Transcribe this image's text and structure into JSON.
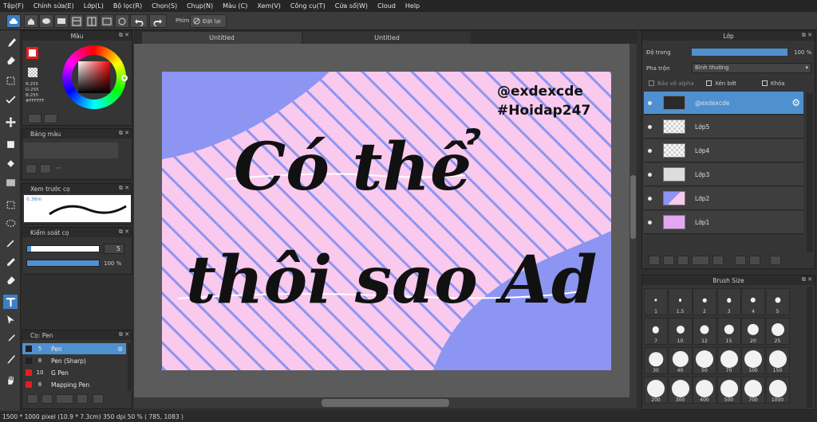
{
  "menu": [
    "Tệp(F)",
    "Chỉnh sửa(E)",
    "Lớp(L)",
    "Bộ lọc(R)",
    "Chọn(S)",
    "Chụp(N)",
    "Màu (C)",
    "Xem(V)",
    "Công cụ(T)",
    "Cửa sổ(W)",
    "Cloud",
    "Help"
  ],
  "toolbar": {
    "prefix": "Phím",
    "reset_label": "Đặt lại"
  },
  "tabs": [
    "Untitled",
    "Untitled"
  ],
  "color_panel": {
    "title": "Màu",
    "readout": "R:255\nG:255\nB:255\n#FFFFFF",
    "primary": "#ffffff",
    "accent": "#e02020"
  },
  "palette_panel": {
    "title": "Bảng màu"
  },
  "preview_panel": {
    "title": "Xem trước cọ",
    "size": "0.36m"
  },
  "brush_control": {
    "title": "Kiểm soát cọ",
    "size_value": "5",
    "opacity_value": "100 %"
  },
  "brush_list": {
    "title": "Cọ: Pen",
    "items": [
      {
        "num": "5",
        "name": "Pen",
        "color": "#222222",
        "selected": true
      },
      {
        "num": "8",
        "name": "Pen (Sharp)",
        "color": "#222222",
        "selected": false
      },
      {
        "num": "10",
        "name": "G Pen",
        "color": "#e02020",
        "selected": false
      },
      {
        "num": "8",
        "name": "Mapping Pen",
        "color": "#e02020",
        "selected": false
      }
    ]
  },
  "artwork": {
    "watermark_line1": "@exdexcde",
    "watermark_line2": "#Hoidap247",
    "line1": "Có thể",
    "line2": "thôi sao Ad",
    "pink": "#f9c9ee",
    "blue": "#8c95f2"
  },
  "layer_panel": {
    "title": "Lớp",
    "opacity_label": "Độ trong",
    "opacity_value": "100 %",
    "opacity_fill": 1.0,
    "blend_label": "Pha trộn",
    "blend_value": "Bình thường",
    "protect_alpha": "Bảo vệ alpha",
    "clip": "Xén bớt",
    "lock": "Khóa",
    "layers": [
      "@exdexcde",
      "Lớp5",
      "Lớp4",
      "Lớp3",
      "Lớp2",
      "Lớp1"
    ]
  },
  "brush_size": {
    "title": "Brush Size",
    "rows": [
      [
        "1",
        "1.5",
        "2",
        "3",
        "4",
        "5"
      ],
      [
        "7",
        "10",
        "12",
        "15",
        "20",
        "25"
      ],
      [
        "30",
        "40",
        "50",
        "70",
        "100",
        "150"
      ],
      [
        "200",
        "300",
        "400",
        "500",
        "700",
        "1000"
      ]
    ]
  },
  "status": "1500 * 1000 pixel  (10.9 * 7.3cm)  350 dpi  50 %  ( 785, 1083 )"
}
